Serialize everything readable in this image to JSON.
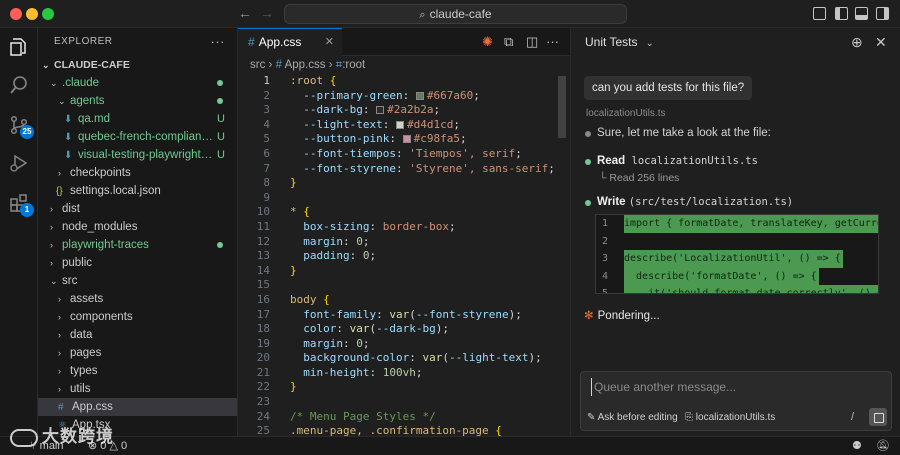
{
  "window": {
    "title": "claude-cafe"
  },
  "activity": {
    "scm_badge": "25",
    "extensions_badge": "1"
  },
  "sidebar": {
    "header": "EXPLORER",
    "more": "···",
    "tree": [
      {
        "label": "CLAUDE-CAFE",
        "chev": "⌄",
        "status": ""
      },
      {
        "label": ".claude",
        "chev": "⌄",
        "status": "dot"
      },
      {
        "label": "agents",
        "chev": "⌄",
        "status": "dot"
      },
      {
        "label": "qa.md",
        "chev": "",
        "status": "U"
      },
      {
        "label": "quebec-french-complian…",
        "chev": "",
        "status": "U"
      },
      {
        "label": "visual-testing-playwright…",
        "chev": "",
        "status": "U"
      },
      {
        "label": "checkpoints",
        "chev": "›",
        "status": ""
      },
      {
        "label": "settings.local.json",
        "chev": "",
        "status": ""
      },
      {
        "label": "dist",
        "chev": "›",
        "status": ""
      },
      {
        "label": "node_modules",
        "chev": "›",
        "status": ""
      },
      {
        "label": "playwright-traces",
        "chev": "›",
        "status": "dot"
      },
      {
        "label": "public",
        "chev": "›",
        "status": ""
      },
      {
        "label": "src",
        "chev": "⌄",
        "status": ""
      },
      {
        "label": "assets",
        "chev": "›",
        "status": ""
      },
      {
        "label": "components",
        "chev": "›",
        "status": ""
      },
      {
        "label": "data",
        "chev": "›",
        "status": ""
      },
      {
        "label": "pages",
        "chev": "›",
        "status": ""
      },
      {
        "label": "types",
        "chev": "›",
        "status": ""
      },
      {
        "label": "utils",
        "chev": "›",
        "status": ""
      },
      {
        "label": "App.css",
        "chev": "",
        "status": ""
      },
      {
        "label": "App.tsx",
        "chev": "",
        "status": ""
      }
    ]
  },
  "editor": {
    "tab_label": "App.css",
    "breadcrumb": {
      "folder": "src",
      "sep": "›",
      "file": "App.css",
      "symbol": ":root"
    }
  },
  "code": {
    "line_numbers": [
      "1",
      "2",
      "3",
      "4",
      "5",
      "6",
      "7",
      "8",
      "9",
      "10",
      "11",
      "12",
      "13",
      "14",
      "15",
      "16",
      "17",
      "18",
      "19",
      "20",
      "21",
      "22",
      "23",
      "24",
      "25"
    ],
    "l1_sel": ":root",
    "l1_open": " {",
    "l2_prop": "--primary-green",
    "l2_val": "#667a60",
    "l3_prop": "--dark-bg",
    "l3_val": "#2a2b2a",
    "l4_prop": "--light-text",
    "l4_val": "#d4d1cd",
    "l5_prop": "--button-pink",
    "l5_val": "#c98fa5",
    "l6_prop": "--font-tiempos",
    "l6_val": "'Tiempos', serif",
    "l7_prop": "--font-styrene",
    "l7_val": "'Styrene', sans-serif",
    "l8": "}",
    "l10_sel": "*",
    "l10_open": " {",
    "l11_prop": "box-sizing",
    "l11_val": "border-box",
    "l12_prop": "margin",
    "l12_val": "0",
    "l13_prop": "padding",
    "l13_val": "0",
    "l14": "}",
    "l16_sel": "body",
    "l16_open": " {",
    "l17_prop": "font-family",
    "l17_fn": "var",
    "l17_arg": "--font-styrene",
    "l18_prop": "color",
    "l18_fn": "var",
    "l18_arg": "--dark-bg",
    "l19_prop": "margin",
    "l19_val": "0",
    "l20_prop": "background-color",
    "l20_fn": "var",
    "l20_arg": "--light-text",
    "l21_prop": "min-height",
    "l21_val": "100vh",
    "l22": "}",
    "l24_comment": "/* Menu Page Styles */",
    "l25_sel": ".menu-page, .confirmation-page",
    "l25_open": " {"
  },
  "swatches": {
    "l2": "#667a60",
    "l3": "#2a2b2a",
    "l4": "#d4d1cd",
    "l5": "#c98fa5"
  },
  "chat": {
    "title": "Unit Tests",
    "user_message": "can you add tests for this file?",
    "context_file": "localizationUtils.ts",
    "msg1": "Sure, let me take a look at the file:",
    "read_label": "Read",
    "read_file": "localizationUtils.ts",
    "read_detail": "Read 256 lines",
    "write_label": "Write",
    "write_path": "(src/test/localization.ts)",
    "diff": [
      {
        "n": "1",
        "code": "import { formatDate, translateKey, getCurrencyS"
      },
      {
        "n": "2",
        "code": ""
      },
      {
        "n": "3",
        "code": "describe('LocalizationUtil', () => {"
      },
      {
        "n": "4",
        "code": "  describe('formatDate', () => {"
      },
      {
        "n": "5",
        "code": "    it('should format date correctly', () => {"
      }
    ],
    "pondering": "Pondering...",
    "composer": {
      "placeholder": "Queue another message...",
      "ask_label": "Ask before editing",
      "file_label": "localizationUtils.ts",
      "slash": "/"
    }
  },
  "statusbar": {
    "branch": "main",
    "errors": "0",
    "warnings": "0",
    "watermark": "大数跨境"
  },
  "colors": {
    "accent": "#0078d4",
    "added_green": "#73c991",
    "diff_added_bg": "#4c9a52",
    "spark": "#e8703a"
  }
}
